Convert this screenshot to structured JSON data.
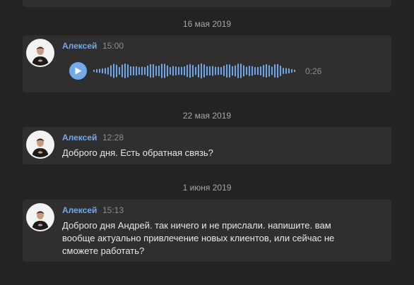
{
  "messages": [
    {
      "date": "16 мая 2019",
      "author": "Алексей",
      "time": "15:00",
      "type": "voice",
      "voice": {
        "duration": "0:26"
      }
    },
    {
      "date": "22 мая 2019",
      "author": "Алексей",
      "time": "12:28",
      "type": "text",
      "text": "Доброго дня. Есть обратная связь?"
    },
    {
      "date": "1 июня 2019",
      "author": "Алексей",
      "time": "15:13",
      "type": "text",
      "text": "Доброго дня Андрей. так ничего и не прислали. напишите. вам вообще актуально привлечение новых клиентов, или сейчас не сможете работать?"
    }
  ],
  "colors": {
    "background": "#232323",
    "card": "#2f2f2f",
    "accent": "#71aaeb",
    "text": "#e7e8ea",
    "muted": "#8d8d8d"
  },
  "icons": {
    "play": "play-icon",
    "avatar": "user-photo"
  }
}
